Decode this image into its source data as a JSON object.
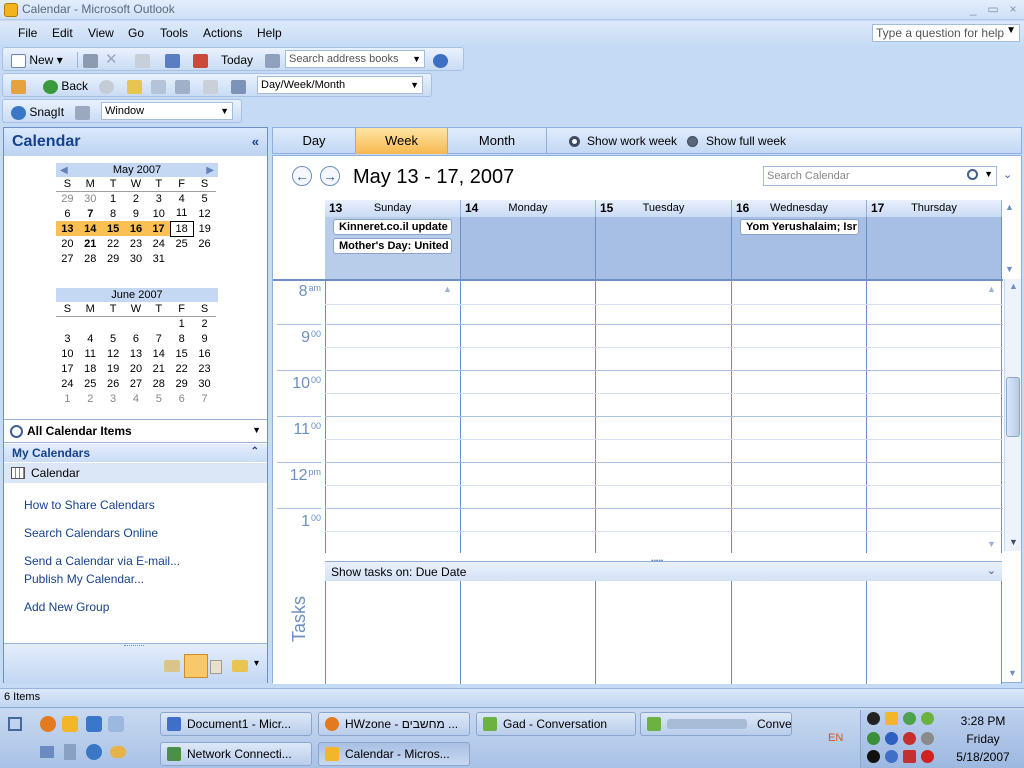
{
  "window": {
    "title": "Calendar - Microsoft Outlook",
    "minimize": "_",
    "maximize": "▭",
    "close": "×"
  },
  "menubar": {
    "items": [
      "File",
      "Edit",
      "View",
      "Go",
      "Tools",
      "Actions",
      "Help"
    ],
    "help_placeholder": "Type a question for help"
  },
  "toolbar1": {
    "new_label": "New",
    "today_label": "Today",
    "search_address_placeholder": "Search address books"
  },
  "toolbar2": {
    "back_label": "Back",
    "view_select": "Day/Week/Month"
  },
  "toolbar3": {
    "snagit_label": "SnagIt",
    "snagit_select": "Window"
  },
  "navpane": {
    "title": "Calendar",
    "collapse": "«",
    "may": {
      "title": "May 2007",
      "dow": [
        "S",
        "M",
        "T",
        "W",
        "T",
        "F",
        "S"
      ],
      "weeks": [
        [
          "29",
          "30",
          "1",
          "2",
          "3",
          "4",
          "5"
        ],
        [
          "6",
          "7",
          "8",
          "9",
          "10",
          "11",
          "12"
        ],
        [
          "13",
          "14",
          "15",
          "16",
          "17",
          "18",
          "19"
        ],
        [
          "20",
          "21",
          "22",
          "23",
          "24",
          "25",
          "26"
        ],
        [
          "27",
          "28",
          "29",
          "30",
          "31",
          "",
          ""
        ]
      ]
    },
    "june": {
      "title": "June 2007",
      "dow": [
        "S",
        "M",
        "T",
        "W",
        "T",
        "F",
        "S"
      ],
      "weeks": [
        [
          "",
          "",
          "",
          "",
          "",
          "1",
          "2"
        ],
        [
          "3",
          "4",
          "5",
          "6",
          "7",
          "8",
          "9"
        ],
        [
          "10",
          "11",
          "12",
          "13",
          "14",
          "15",
          "16"
        ],
        [
          "17",
          "18",
          "19",
          "20",
          "21",
          "22",
          "23"
        ],
        [
          "24",
          "25",
          "26",
          "27",
          "28",
          "29",
          "30"
        ],
        [
          "1",
          "2",
          "3",
          "4",
          "5",
          "6",
          "7"
        ]
      ]
    },
    "all_items": "All Calendar Items",
    "my_calendars": "My Calendars",
    "calendar_item": "Calendar",
    "links": [
      "How to Share Calendars",
      "Search Calendars Online",
      "Send a Calendar via E-mail...",
      "Publish My Calendar...",
      "Add New Group"
    ]
  },
  "viewtabs": {
    "day": "Day",
    "week": "Week",
    "month": "Month",
    "show_work_week": "Show work week",
    "show_full_week": "Show full week"
  },
  "calendar": {
    "date_range": "May 13 - 17, 2007",
    "search_placeholder": "Search Calendar",
    "days": [
      {
        "num": "13",
        "name": "Sunday"
      },
      {
        "num": "14",
        "name": "Monday"
      },
      {
        "num": "15",
        "name": "Tuesday"
      },
      {
        "num": "16",
        "name": "Wednesday"
      },
      {
        "num": "17",
        "name": "Thursday"
      }
    ],
    "events": [
      {
        "day": 0,
        "title": "Kinneret.co.il update"
      },
      {
        "day": 0,
        "title": "Mother's Day: United"
      },
      {
        "day": 3,
        "title": "Yom Yerushalaim; Isr"
      }
    ],
    "hours": [
      {
        "h": "8",
        "s": "am"
      },
      {
        "h": "9",
        "s": "00"
      },
      {
        "h": "10",
        "s": "00"
      },
      {
        "h": "11",
        "s": "00"
      },
      {
        "h": "12",
        "s": "pm"
      },
      {
        "h": "1",
        "s": "00"
      }
    ],
    "tasks_header": "Show tasks on: Due Date",
    "tasks_label": "Tasks"
  },
  "status": {
    "items": "6 Items"
  },
  "taskbar": {
    "windows_row1": [
      "Document1 - Micr...",
      "HWzone - מחשבים ...",
      "Gad - Conversation",
      "Conve..."
    ],
    "windows_row2": [
      "Network Connecti...",
      "Calendar - Micros..."
    ],
    "lang": "EN",
    "time": "3:28 PM",
    "day": "Friday",
    "date": "5/18/2007"
  }
}
